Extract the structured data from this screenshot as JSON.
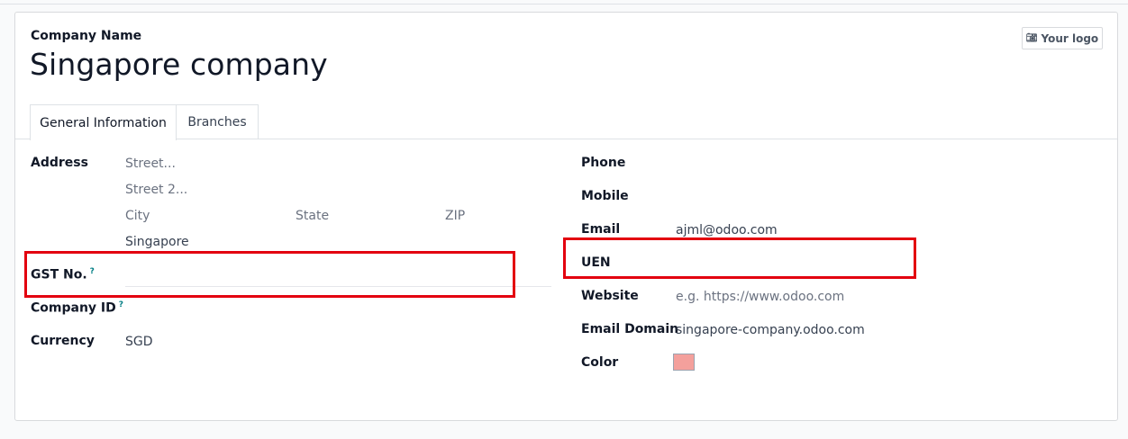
{
  "header": {
    "company_label": "Company Name",
    "company_name": "Singapore company",
    "logo_button": "Your logo"
  },
  "tabs": [
    {
      "label": "General Information",
      "active": true
    },
    {
      "label": "Branches",
      "active": false
    }
  ],
  "left": {
    "address_label": "Address",
    "street_placeholder": "Street...",
    "street2_placeholder": "Street 2...",
    "city_placeholder": "City",
    "state_placeholder": "State",
    "zip_placeholder": "ZIP",
    "country_value": "Singapore",
    "gst_label": "GST No.",
    "gst_help": "?",
    "company_id_label": "Company ID",
    "company_id_help": "?",
    "currency_label": "Currency",
    "currency_value": "SGD"
  },
  "right": {
    "phone_label": "Phone",
    "mobile_label": "Mobile",
    "email_label": "Email",
    "email_value": "ajml@odoo.com",
    "uen_label": "UEN",
    "website_label": "Website",
    "website_placeholder": "e.g. https://www.odoo.com",
    "email_domain_label": "Email Domain",
    "email_domain_value": "singapore-company.odoo.com",
    "color_label": "Color",
    "color_value": "#f4a09c"
  },
  "highlight_color": "#e3000f",
  "icons": {
    "camera": "camera-icon"
  }
}
